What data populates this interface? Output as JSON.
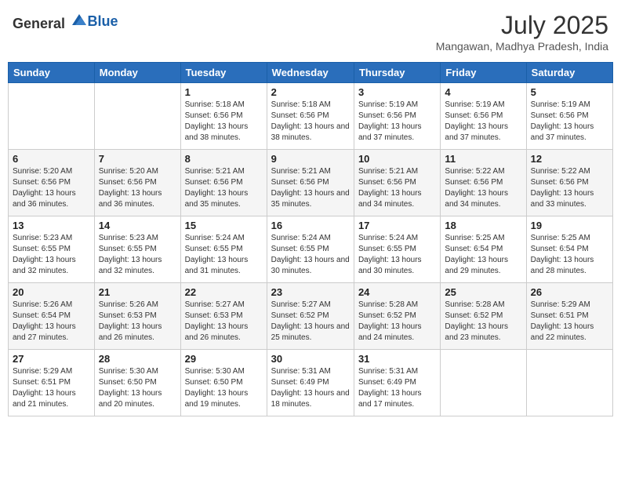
{
  "header": {
    "logo_general": "General",
    "logo_blue": "Blue",
    "month": "July 2025",
    "location": "Mangawan, Madhya Pradesh, India"
  },
  "days_of_week": [
    "Sunday",
    "Monday",
    "Tuesday",
    "Wednesday",
    "Thursday",
    "Friday",
    "Saturday"
  ],
  "weeks": [
    [
      {
        "day": "",
        "detail": ""
      },
      {
        "day": "",
        "detail": ""
      },
      {
        "day": "1",
        "detail": "Sunrise: 5:18 AM\nSunset: 6:56 PM\nDaylight: 13 hours and 38 minutes."
      },
      {
        "day": "2",
        "detail": "Sunrise: 5:18 AM\nSunset: 6:56 PM\nDaylight: 13 hours and 38 minutes."
      },
      {
        "day": "3",
        "detail": "Sunrise: 5:19 AM\nSunset: 6:56 PM\nDaylight: 13 hours and 37 minutes."
      },
      {
        "day": "4",
        "detail": "Sunrise: 5:19 AM\nSunset: 6:56 PM\nDaylight: 13 hours and 37 minutes."
      },
      {
        "day": "5",
        "detail": "Sunrise: 5:19 AM\nSunset: 6:56 PM\nDaylight: 13 hours and 37 minutes."
      }
    ],
    [
      {
        "day": "6",
        "detail": "Sunrise: 5:20 AM\nSunset: 6:56 PM\nDaylight: 13 hours and 36 minutes."
      },
      {
        "day": "7",
        "detail": "Sunrise: 5:20 AM\nSunset: 6:56 PM\nDaylight: 13 hours and 36 minutes."
      },
      {
        "day": "8",
        "detail": "Sunrise: 5:21 AM\nSunset: 6:56 PM\nDaylight: 13 hours and 35 minutes."
      },
      {
        "day": "9",
        "detail": "Sunrise: 5:21 AM\nSunset: 6:56 PM\nDaylight: 13 hours and 35 minutes."
      },
      {
        "day": "10",
        "detail": "Sunrise: 5:21 AM\nSunset: 6:56 PM\nDaylight: 13 hours and 34 minutes."
      },
      {
        "day": "11",
        "detail": "Sunrise: 5:22 AM\nSunset: 6:56 PM\nDaylight: 13 hours and 34 minutes."
      },
      {
        "day": "12",
        "detail": "Sunrise: 5:22 AM\nSunset: 6:56 PM\nDaylight: 13 hours and 33 minutes."
      }
    ],
    [
      {
        "day": "13",
        "detail": "Sunrise: 5:23 AM\nSunset: 6:55 PM\nDaylight: 13 hours and 32 minutes."
      },
      {
        "day": "14",
        "detail": "Sunrise: 5:23 AM\nSunset: 6:55 PM\nDaylight: 13 hours and 32 minutes."
      },
      {
        "day": "15",
        "detail": "Sunrise: 5:24 AM\nSunset: 6:55 PM\nDaylight: 13 hours and 31 minutes."
      },
      {
        "day": "16",
        "detail": "Sunrise: 5:24 AM\nSunset: 6:55 PM\nDaylight: 13 hours and 30 minutes."
      },
      {
        "day": "17",
        "detail": "Sunrise: 5:24 AM\nSunset: 6:55 PM\nDaylight: 13 hours and 30 minutes."
      },
      {
        "day": "18",
        "detail": "Sunrise: 5:25 AM\nSunset: 6:54 PM\nDaylight: 13 hours and 29 minutes."
      },
      {
        "day": "19",
        "detail": "Sunrise: 5:25 AM\nSunset: 6:54 PM\nDaylight: 13 hours and 28 minutes."
      }
    ],
    [
      {
        "day": "20",
        "detail": "Sunrise: 5:26 AM\nSunset: 6:54 PM\nDaylight: 13 hours and 27 minutes."
      },
      {
        "day": "21",
        "detail": "Sunrise: 5:26 AM\nSunset: 6:53 PM\nDaylight: 13 hours and 26 minutes."
      },
      {
        "day": "22",
        "detail": "Sunrise: 5:27 AM\nSunset: 6:53 PM\nDaylight: 13 hours and 26 minutes."
      },
      {
        "day": "23",
        "detail": "Sunrise: 5:27 AM\nSunset: 6:52 PM\nDaylight: 13 hours and 25 minutes."
      },
      {
        "day": "24",
        "detail": "Sunrise: 5:28 AM\nSunset: 6:52 PM\nDaylight: 13 hours and 24 minutes."
      },
      {
        "day": "25",
        "detail": "Sunrise: 5:28 AM\nSunset: 6:52 PM\nDaylight: 13 hours and 23 minutes."
      },
      {
        "day": "26",
        "detail": "Sunrise: 5:29 AM\nSunset: 6:51 PM\nDaylight: 13 hours and 22 minutes."
      }
    ],
    [
      {
        "day": "27",
        "detail": "Sunrise: 5:29 AM\nSunset: 6:51 PM\nDaylight: 13 hours and 21 minutes."
      },
      {
        "day": "28",
        "detail": "Sunrise: 5:30 AM\nSunset: 6:50 PM\nDaylight: 13 hours and 20 minutes."
      },
      {
        "day": "29",
        "detail": "Sunrise: 5:30 AM\nSunset: 6:50 PM\nDaylight: 13 hours and 19 minutes."
      },
      {
        "day": "30",
        "detail": "Sunrise: 5:31 AM\nSunset: 6:49 PM\nDaylight: 13 hours and 18 minutes."
      },
      {
        "day": "31",
        "detail": "Sunrise: 5:31 AM\nSunset: 6:49 PM\nDaylight: 13 hours and 17 minutes."
      },
      {
        "day": "",
        "detail": ""
      },
      {
        "day": "",
        "detail": ""
      }
    ]
  ]
}
